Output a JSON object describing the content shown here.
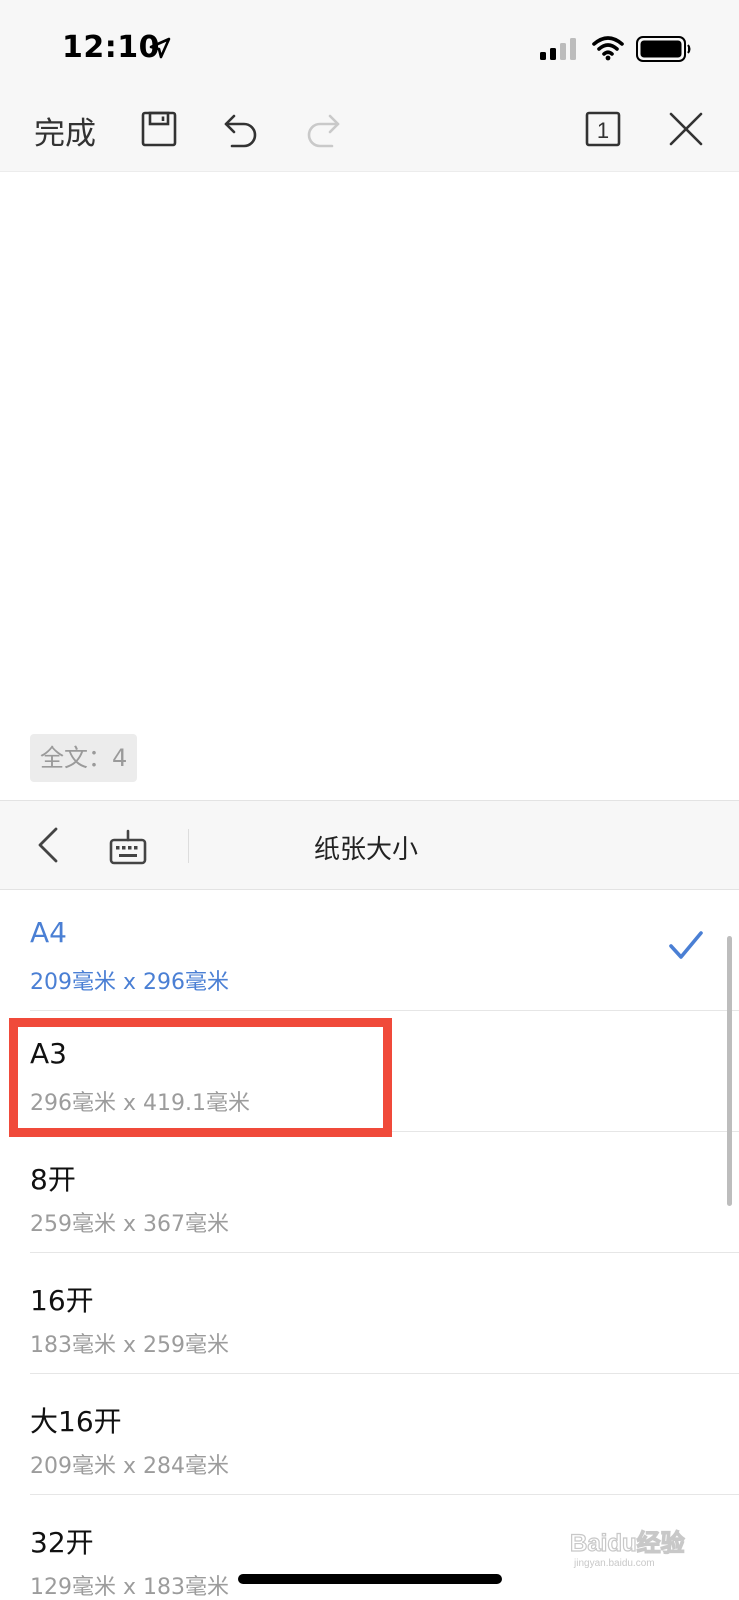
{
  "status_bar": {
    "time": "12:10",
    "icons": [
      "location-arrow-icon",
      "cellular-signal-icon",
      "wifi-icon",
      "battery-icon"
    ]
  },
  "toolbar": {
    "done_label": "完成",
    "icons": [
      "save-icon",
      "undo-icon",
      "redo-icon",
      "page-count-icon",
      "close-icon"
    ],
    "page_indicator": "1"
  },
  "document": {
    "word_count": "全文：4"
  },
  "panel": {
    "title": "纸张大小",
    "icons": [
      "back-chevron-icon",
      "keyboard-icon"
    ]
  },
  "paper_sizes": [
    {
      "name": "A4",
      "size": "209毫米 x 296毫米",
      "selected": true
    },
    {
      "name": "A3",
      "size": "296毫米 x 419.1毫米",
      "selected": false
    },
    {
      "name": "8开",
      "size": "259毫米 x 367毫米",
      "selected": false
    },
    {
      "name": "16开",
      "size": "183毫米 x 259毫米",
      "selected": false
    },
    {
      "name": "大16开",
      "size": "209毫米 x 284毫米",
      "selected": false
    },
    {
      "name": "32开",
      "size": "129毫米 x 183毫米",
      "selected": false
    }
  ],
  "colors": {
    "accent": "#4a7fd4",
    "highlight": "#f04a3a",
    "secondary_text": "#9c9c9c"
  },
  "watermark": {
    "text": "Baidu经验",
    "subtext": "jingyan.baidu.com"
  }
}
